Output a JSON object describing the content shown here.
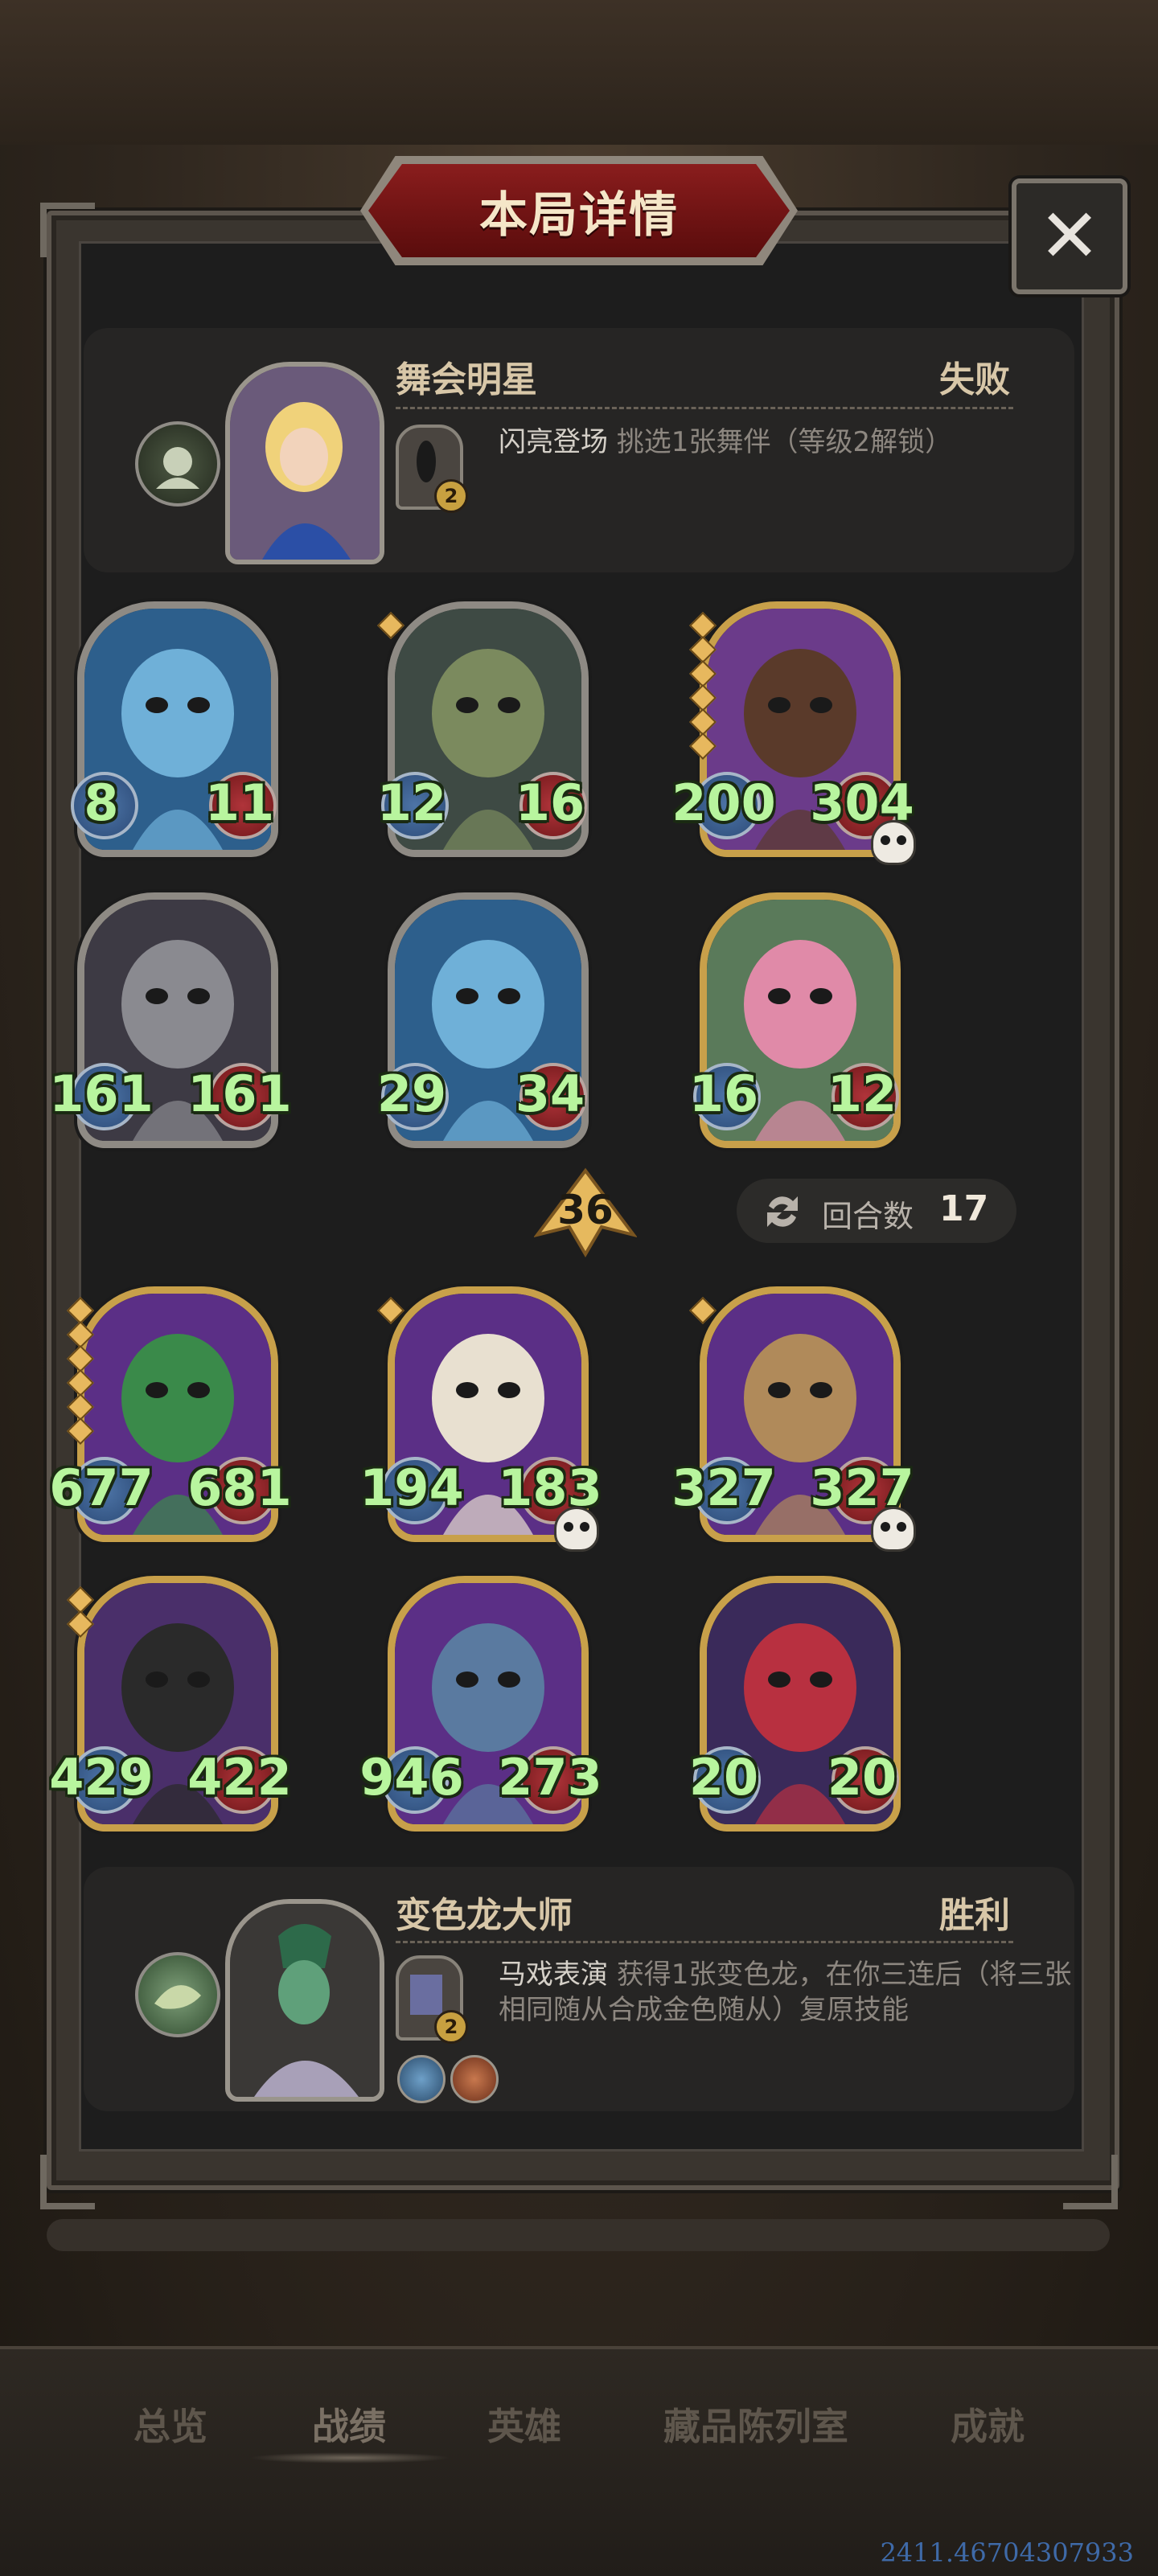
{
  "title": "本局详情",
  "close_icon": "close-icon",
  "opponent": {
    "name": "舞会明星",
    "result": "失败",
    "power_name": "闪亮登场",
    "power_desc": "挑选1张舞伴（等级2解锁）",
    "power_level": "2"
  },
  "player": {
    "name": "变色龙大师",
    "result": "胜利",
    "power_name": "马戏表演",
    "power_desc": "获得1张变色龙，在你三连后（将三张相同随从合成金色随从）复原技能",
    "power_level": "2"
  },
  "opponent_board": [
    {
      "attack": "8",
      "health": "11",
      "golden": false
    },
    {
      "attack": "12",
      "health": "16",
      "golden": false
    },
    {
      "attack": "200",
      "health": "304",
      "golden": true
    },
    {
      "attack": "161",
      "health": "161",
      "golden": false
    },
    {
      "attack": "29",
      "health": "34",
      "golden": false
    },
    {
      "attack": "16",
      "health": "12",
      "golden": true
    }
  ],
  "player_board": [
    {
      "attack": "677",
      "health": "681",
      "golden": true
    },
    {
      "attack": "194",
      "health": "183",
      "golden": true
    },
    {
      "attack": "327",
      "health": "327",
      "golden": true
    },
    {
      "attack": "429",
      "health": "422",
      "golden": true
    },
    {
      "attack": "946",
      "health": "273",
      "golden": true
    },
    {
      "attack": "20",
      "health": "20",
      "golden": true
    }
  ],
  "tavern_tier": "36",
  "turns": {
    "label": "回合数",
    "value": "17"
  },
  "nav": {
    "overview": "总览",
    "record": "战绩",
    "heroes": "英雄",
    "collection": "藏品陈列室",
    "achievements": "成就"
  },
  "coordinates": "2411.46704307933",
  "colors": {
    "panel_bg": "#1d1d1d",
    "stat_text": "#b8f59e",
    "gold_frame": "#c8a04a",
    "title_banner": "#8a1d1d"
  }
}
